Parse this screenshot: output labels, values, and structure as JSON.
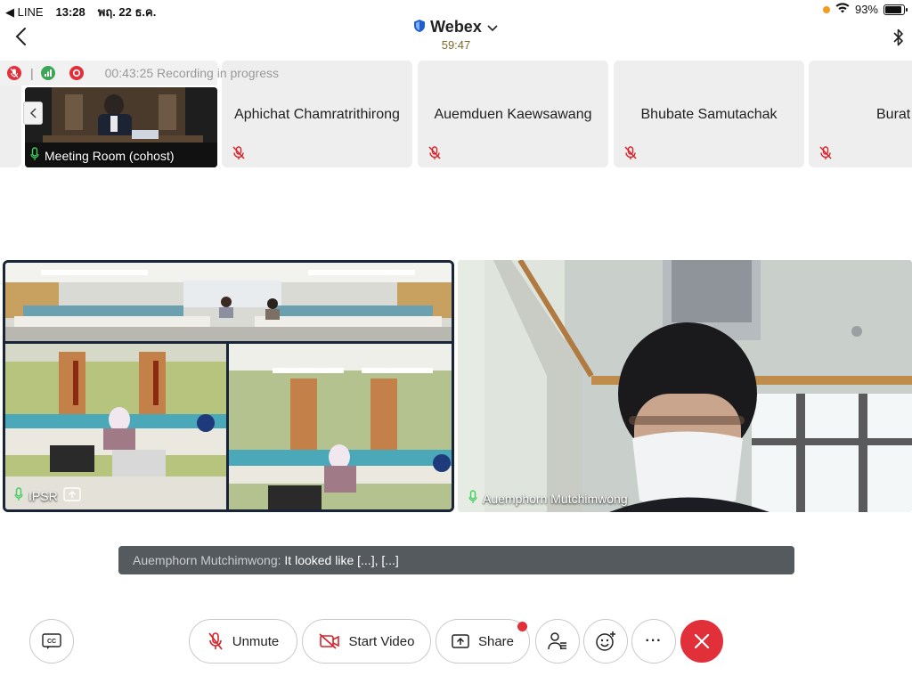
{
  "status_bar": {
    "back_app": "◀ LINE",
    "time": "13:28",
    "date": "พฤ. 22 ธ.ค.",
    "battery": "93%",
    "battery_level": 0.93
  },
  "header": {
    "title": "Webex",
    "timer": "59:47"
  },
  "recording": {
    "text": "00:43:25 Recording in progress"
  },
  "participants": [
    {
      "name": "Meeting Room (cohost)"
    },
    {
      "name": "Aphichat Chamratrithirong"
    },
    {
      "name": "Auemduen Kaewsawang"
    },
    {
      "name": "Bhubate Samutachak"
    },
    {
      "name": "Burat"
    }
  ],
  "videos": {
    "left_label": "IPSR",
    "right_label": "Auemphorn Mutchimwong"
  },
  "caption": {
    "speaker": "Auemphorn Mutchimwong:",
    "text": "It looked like [...], [...]"
  },
  "controls": {
    "cc": "CC",
    "unmute": "Unmute",
    "start_video": "Start Video",
    "share": "Share",
    "more": "···"
  },
  "colors": {
    "end_call": "#e2303a",
    "caption_bg": "#555a5e",
    "active_border": "#17243a",
    "recording_red": "#e2303a",
    "recording_green": "#3aa757"
  }
}
